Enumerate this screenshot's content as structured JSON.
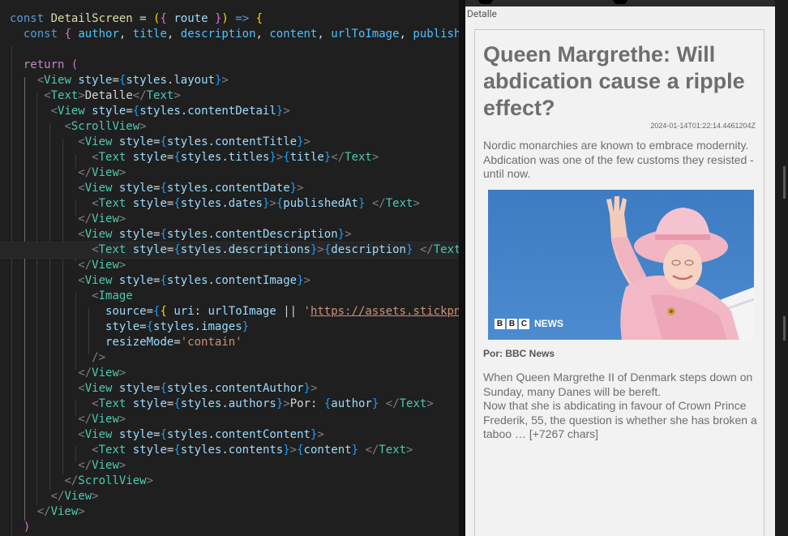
{
  "editor": {
    "lines": [
      [
        [
          "kw",
          "const"
        ],
        [
          "txt",
          " "
        ],
        [
          "fn",
          "DetailScreen"
        ],
        [
          "txt",
          " = "
        ],
        [
          "p1",
          "("
        ],
        [
          "p2",
          "{"
        ],
        [
          "txt",
          " "
        ],
        [
          "var",
          "route"
        ],
        [
          "txt",
          " "
        ],
        [
          "p2",
          "}"
        ],
        [
          "p1",
          ")"
        ],
        [
          "txt",
          " "
        ],
        [
          "kw",
          "=>"
        ],
        [
          "txt",
          " "
        ],
        [
          "p1",
          "{"
        ]
      ],
      [
        [
          "txt",
          "  "
        ],
        [
          "kw",
          "const"
        ],
        [
          "txt",
          " "
        ],
        [
          "p2",
          "{"
        ],
        [
          "txt",
          " "
        ],
        [
          "const",
          "author"
        ],
        [
          "txt",
          ", "
        ],
        [
          "const",
          "title"
        ],
        [
          "txt",
          ", "
        ],
        [
          "const",
          "description"
        ],
        [
          "txt",
          ", "
        ],
        [
          "const",
          "content"
        ],
        [
          "txt",
          ", "
        ],
        [
          "const",
          "urlToImage"
        ],
        [
          "txt",
          ", "
        ],
        [
          "const",
          "publishedAt"
        ],
        [
          "txt",
          " "
        ],
        [
          "p2",
          "}"
        ]
      ],
      [],
      [
        [
          "txt",
          "  "
        ],
        [
          "ctl",
          "return"
        ],
        [
          "txt",
          " "
        ],
        [
          "p2",
          "("
        ]
      ],
      [
        [
          "txt",
          "    "
        ],
        [
          "br",
          "<"
        ],
        [
          "tag",
          "View"
        ],
        [
          "txt",
          " "
        ],
        [
          "var",
          "style"
        ],
        [
          "txt",
          "="
        ],
        [
          "p3",
          "{"
        ],
        [
          "var",
          "styles"
        ],
        [
          "txt",
          "."
        ],
        [
          "var",
          "layout"
        ],
        [
          "p3",
          "}"
        ],
        [
          "br",
          ">"
        ]
      ],
      [
        [
          "txt",
          "     "
        ],
        [
          "br",
          "<"
        ],
        [
          "tag",
          "Text"
        ],
        [
          "br",
          ">"
        ],
        [
          "txt",
          "Detalle"
        ],
        [
          "br",
          "</"
        ],
        [
          "tag",
          "Text"
        ],
        [
          "br",
          ">"
        ]
      ],
      [
        [
          "txt",
          "      "
        ],
        [
          "br",
          "<"
        ],
        [
          "tag",
          "View"
        ],
        [
          "txt",
          " "
        ],
        [
          "var",
          "style"
        ],
        [
          "txt",
          "="
        ],
        [
          "p3",
          "{"
        ],
        [
          "var",
          "styles"
        ],
        [
          "txt",
          "."
        ],
        [
          "var",
          "contentDetail"
        ],
        [
          "p3",
          "}"
        ],
        [
          "br",
          ">"
        ]
      ],
      [
        [
          "txt",
          "        "
        ],
        [
          "br",
          "<"
        ],
        [
          "tag",
          "ScrollView"
        ],
        [
          "br",
          ">"
        ]
      ],
      [
        [
          "txt",
          "          "
        ],
        [
          "br",
          "<"
        ],
        [
          "tag",
          "View"
        ],
        [
          "txt",
          " "
        ],
        [
          "var",
          "style"
        ],
        [
          "txt",
          "="
        ],
        [
          "p3",
          "{"
        ],
        [
          "var",
          "styles"
        ],
        [
          "txt",
          "."
        ],
        [
          "var",
          "contentTitle"
        ],
        [
          "p3",
          "}"
        ],
        [
          "br",
          ">"
        ]
      ],
      [
        [
          "txt",
          "            "
        ],
        [
          "br",
          "<"
        ],
        [
          "tag",
          "Text"
        ],
        [
          "txt",
          " "
        ],
        [
          "var",
          "style"
        ],
        [
          "txt",
          "="
        ],
        [
          "p3",
          "{"
        ],
        [
          "var",
          "styles"
        ],
        [
          "txt",
          "."
        ],
        [
          "var",
          "titles"
        ],
        [
          "p3",
          "}"
        ],
        [
          "br",
          ">"
        ],
        [
          "p3",
          "{"
        ],
        [
          "var",
          "title"
        ],
        [
          "p3",
          "}"
        ],
        [
          "br",
          "</"
        ],
        [
          "tag",
          "Text"
        ],
        [
          "br",
          ">"
        ]
      ],
      [
        [
          "txt",
          "          "
        ],
        [
          "br",
          "</"
        ],
        [
          "tag",
          "View"
        ],
        [
          "br",
          ">"
        ]
      ],
      [
        [
          "txt",
          "          "
        ],
        [
          "br",
          "<"
        ],
        [
          "tag",
          "View"
        ],
        [
          "txt",
          " "
        ],
        [
          "var",
          "style"
        ],
        [
          "txt",
          "="
        ],
        [
          "p3",
          "{"
        ],
        [
          "var",
          "styles"
        ],
        [
          "txt",
          "."
        ],
        [
          "var",
          "contentDate"
        ],
        [
          "p3",
          "}"
        ],
        [
          "br",
          ">"
        ]
      ],
      [
        [
          "txt",
          "            "
        ],
        [
          "br",
          "<"
        ],
        [
          "tag",
          "Text"
        ],
        [
          "txt",
          " "
        ],
        [
          "var",
          "style"
        ],
        [
          "txt",
          "="
        ],
        [
          "p3",
          "{"
        ],
        [
          "var",
          "styles"
        ],
        [
          "txt",
          "."
        ],
        [
          "var",
          "dates"
        ],
        [
          "p3",
          "}"
        ],
        [
          "br",
          ">"
        ],
        [
          "p3",
          "{"
        ],
        [
          "var",
          "publishedAt"
        ],
        [
          "p3",
          "}"
        ],
        [
          "txt",
          " "
        ],
        [
          "br",
          "</"
        ],
        [
          "tag",
          "Text"
        ],
        [
          "br",
          ">"
        ]
      ],
      [
        [
          "txt",
          "          "
        ],
        [
          "br",
          "</"
        ],
        [
          "tag",
          "View"
        ],
        [
          "br",
          ">"
        ]
      ],
      [
        [
          "txt",
          "          "
        ],
        [
          "br",
          "<"
        ],
        [
          "tag",
          "View"
        ],
        [
          "txt",
          " "
        ],
        [
          "var",
          "style"
        ],
        [
          "txt",
          "="
        ],
        [
          "p3",
          "{"
        ],
        [
          "var",
          "styles"
        ],
        [
          "txt",
          "."
        ],
        [
          "var",
          "contentDescription"
        ],
        [
          "p3",
          "}"
        ],
        [
          "br",
          ">"
        ]
      ],
      [
        [
          "txt",
          "            "
        ],
        [
          "br",
          "<"
        ],
        [
          "tag",
          "Text"
        ],
        [
          "txt",
          " "
        ],
        [
          "var",
          "style"
        ],
        [
          "txt",
          "="
        ],
        [
          "p3",
          "{"
        ],
        [
          "var",
          "styles"
        ],
        [
          "txt",
          "."
        ],
        [
          "var",
          "descriptions"
        ],
        [
          "p3",
          "}"
        ],
        [
          "br",
          ">"
        ],
        [
          "p3",
          "{"
        ],
        [
          "var",
          "description"
        ],
        [
          "p3",
          "}"
        ],
        [
          "txt",
          " "
        ],
        [
          "br",
          "</"
        ],
        [
          "tag",
          "Text"
        ],
        [
          "br",
          ">"
        ]
      ],
      [
        [
          "txt",
          "          "
        ],
        [
          "br",
          "</"
        ],
        [
          "tag",
          "View"
        ],
        [
          "br",
          ">"
        ]
      ],
      [
        [
          "txt",
          "          "
        ],
        [
          "br",
          "<"
        ],
        [
          "tag",
          "View"
        ],
        [
          "txt",
          " "
        ],
        [
          "var",
          "style"
        ],
        [
          "txt",
          "="
        ],
        [
          "p3",
          "{"
        ],
        [
          "var",
          "styles"
        ],
        [
          "txt",
          "."
        ],
        [
          "var",
          "contentImage"
        ],
        [
          "p3",
          "}"
        ],
        [
          "br",
          ">"
        ]
      ],
      [
        [
          "txt",
          "            "
        ],
        [
          "br",
          "<"
        ],
        [
          "tag",
          "Image"
        ]
      ],
      [
        [
          "txt",
          "              "
        ],
        [
          "var",
          "source"
        ],
        [
          "txt",
          "="
        ],
        [
          "p3",
          "{"
        ],
        [
          "p1",
          "{"
        ],
        [
          "txt",
          " "
        ],
        [
          "var",
          "uri"
        ],
        [
          "txt",
          ": "
        ],
        [
          "var",
          "urlToImage"
        ],
        [
          "txt",
          " || "
        ],
        [
          "str",
          "'"
        ],
        [
          "url",
          "https://assets.stickpng.com/"
        ]
      ],
      [
        [
          "txt",
          "              "
        ],
        [
          "var",
          "style"
        ],
        [
          "txt",
          "="
        ],
        [
          "p3",
          "{"
        ],
        [
          "var",
          "styles"
        ],
        [
          "txt",
          "."
        ],
        [
          "var",
          "images"
        ],
        [
          "p3",
          "}"
        ]
      ],
      [
        [
          "txt",
          "              "
        ],
        [
          "var",
          "resizeMode"
        ],
        [
          "txt",
          "="
        ],
        [
          "str",
          "'contain'"
        ]
      ],
      [
        [
          "txt",
          "            "
        ],
        [
          "br",
          "/>"
        ]
      ],
      [
        [
          "txt",
          "          "
        ],
        [
          "br",
          "</"
        ],
        [
          "tag",
          "View"
        ],
        [
          "br",
          ">"
        ]
      ],
      [
        [
          "txt",
          "          "
        ],
        [
          "br",
          "<"
        ],
        [
          "tag",
          "View"
        ],
        [
          "txt",
          " "
        ],
        [
          "var",
          "style"
        ],
        [
          "txt",
          "="
        ],
        [
          "p3",
          "{"
        ],
        [
          "var",
          "styles"
        ],
        [
          "txt",
          "."
        ],
        [
          "var",
          "contentAuthor"
        ],
        [
          "p3",
          "}"
        ],
        [
          "br",
          ">"
        ]
      ],
      [
        [
          "txt",
          "            "
        ],
        [
          "br",
          "<"
        ],
        [
          "tag",
          "Text"
        ],
        [
          "txt",
          " "
        ],
        [
          "var",
          "style"
        ],
        [
          "txt",
          "="
        ],
        [
          "p3",
          "{"
        ],
        [
          "var",
          "styles"
        ],
        [
          "txt",
          "."
        ],
        [
          "var",
          "authors"
        ],
        [
          "p3",
          "}"
        ],
        [
          "br",
          ">"
        ],
        [
          "txt",
          "Por: "
        ],
        [
          "p3",
          "{"
        ],
        [
          "var",
          "author"
        ],
        [
          "p3",
          "}"
        ],
        [
          "txt",
          " "
        ],
        [
          "br",
          "</"
        ],
        [
          "tag",
          "Text"
        ],
        [
          "br",
          ">"
        ]
      ],
      [
        [
          "txt",
          "          "
        ],
        [
          "br",
          "</"
        ],
        [
          "tag",
          "View"
        ],
        [
          "br",
          ">"
        ]
      ],
      [
        [
          "txt",
          "          "
        ],
        [
          "br",
          "<"
        ],
        [
          "tag",
          "View"
        ],
        [
          "txt",
          " "
        ],
        [
          "var",
          "style"
        ],
        [
          "txt",
          "="
        ],
        [
          "p3",
          "{"
        ],
        [
          "var",
          "styles"
        ],
        [
          "txt",
          "."
        ],
        [
          "var",
          "contentContent"
        ],
        [
          "p3",
          "}"
        ],
        [
          "br",
          ">"
        ]
      ],
      [
        [
          "txt",
          "            "
        ],
        [
          "br",
          "<"
        ],
        [
          "tag",
          "Text"
        ],
        [
          "txt",
          " "
        ],
        [
          "var",
          "style"
        ],
        [
          "txt",
          "="
        ],
        [
          "p3",
          "{"
        ],
        [
          "var",
          "styles"
        ],
        [
          "txt",
          "."
        ],
        [
          "var",
          "contents"
        ],
        [
          "p3",
          "}"
        ],
        [
          "br",
          ">"
        ],
        [
          "p3",
          "{"
        ],
        [
          "var",
          "content"
        ],
        [
          "p3",
          "}"
        ],
        [
          "txt",
          " "
        ],
        [
          "br",
          "</"
        ],
        [
          "tag",
          "Text"
        ],
        [
          "br",
          ">"
        ]
      ],
      [
        [
          "txt",
          "          "
        ],
        [
          "br",
          "</"
        ],
        [
          "tag",
          "View"
        ],
        [
          "br",
          ">"
        ]
      ],
      [
        [
          "txt",
          "        "
        ],
        [
          "br",
          "</"
        ],
        [
          "tag",
          "ScrollView"
        ],
        [
          "br",
          ">"
        ]
      ],
      [
        [
          "txt",
          "      "
        ],
        [
          "br",
          "</"
        ],
        [
          "tag",
          "View"
        ],
        [
          "br",
          ">"
        ]
      ],
      [
        [
          "txt",
          "    "
        ],
        [
          "br",
          "</"
        ],
        [
          "tag",
          "View"
        ],
        [
          "br",
          ">"
        ]
      ],
      [
        [
          "txt",
          "  "
        ],
        [
          "p2",
          ")"
        ]
      ]
    ]
  },
  "preview": {
    "header": "Detalle",
    "title": "Queen Margrethe: Will abdication cause a ripple effect?",
    "published_at": "2024-01-14T01:22:14.4461204Z",
    "description": "Nordic monarchies are known to embrace modernity. Abdication was one of the few customs they resisted - until now.",
    "image": {
      "bbc_letters": [
        "B",
        "B",
        "C"
      ],
      "news_label": "NEWS"
    },
    "author": "Por: BBC News",
    "content": "When Queen Margrethe II of Denmark steps down on Sunday, many Danes will be bereft.\nNow that she is abdicating in favour of Crown Prince Frederik, 55, the question is whether she has broken a taboo … [+7267 chars]"
  }
}
